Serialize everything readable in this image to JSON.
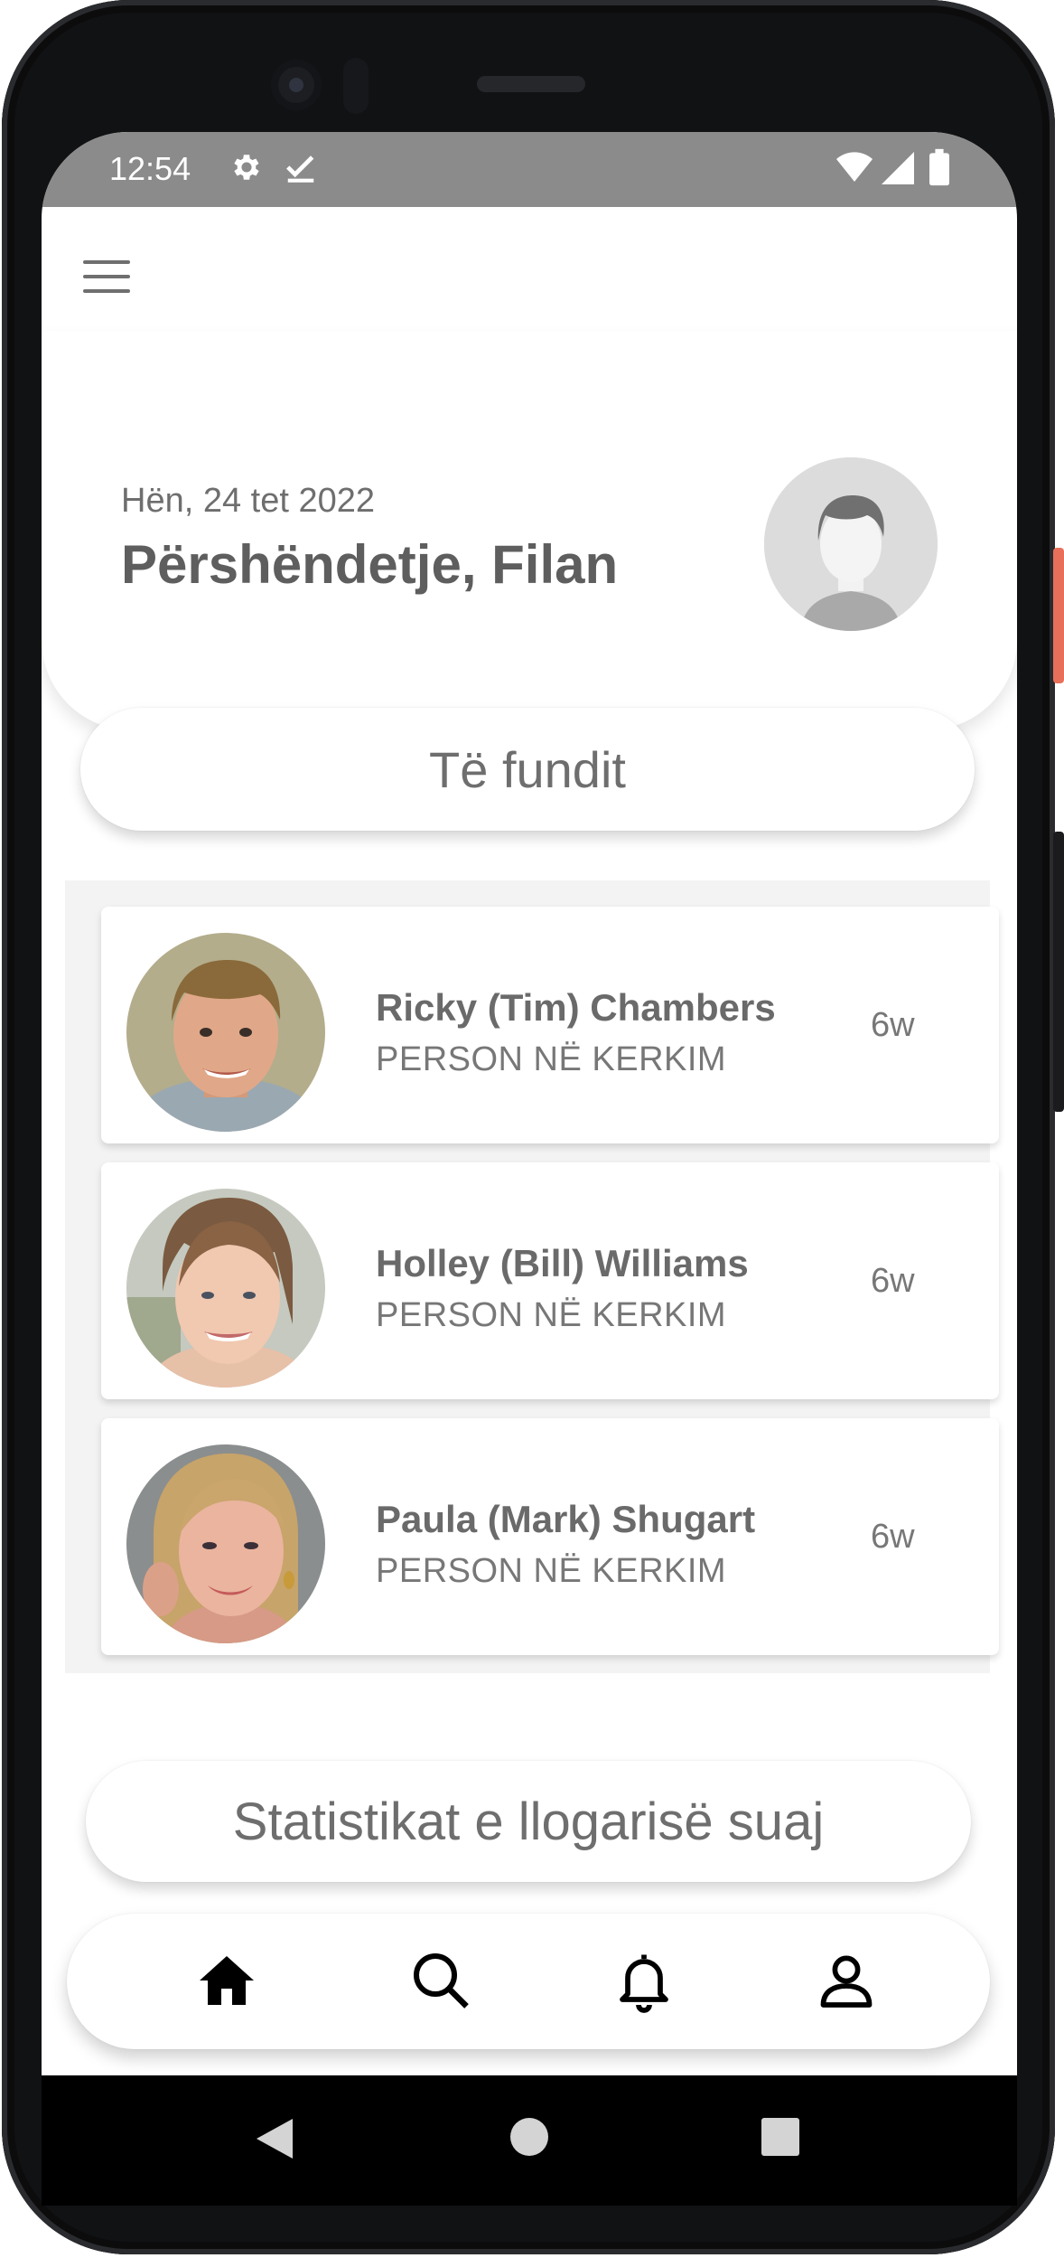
{
  "status_bar": {
    "time": "12:54",
    "left_icons": [
      "settings-gear-icon",
      "download-check-icon"
    ],
    "right_icons": [
      "wifi-icon",
      "cell-signal-icon",
      "battery-icon"
    ]
  },
  "toolbar": {
    "menu_icon": "hamburger-menu-icon"
  },
  "header": {
    "date": "Hën, 24 tet 2022",
    "greeting": "Përshëndetje, Filan",
    "avatar_icon": "default-user-avatar"
  },
  "recent_button": {
    "label": "Të fundit"
  },
  "recent_list": [
    {
      "name": "Ricky (Tim) Chambers",
      "status": "PERSON NË KERKIM",
      "age": "6w"
    },
    {
      "name": "Holley (Bill) Williams",
      "status": "PERSON NË KERKIM",
      "age": "6w"
    },
    {
      "name": "Paula (Mark) Shugart",
      "status": "PERSON NË KERKIM",
      "age": "6w"
    }
  ],
  "stats_button": {
    "label": "Statistikat e llogarisë suaj"
  },
  "bottom_nav": {
    "items": [
      "home-icon",
      "search-icon",
      "bell-icon",
      "profile-icon"
    ],
    "active": "home-icon"
  },
  "system_nav": {
    "items": [
      "back-icon",
      "home-circle-icon",
      "recents-square-icon"
    ]
  },
  "colors": {
    "status_bar": "#8b8b8b",
    "text_primary": "#5e5e5e",
    "panel_bg": "#f3f3f3",
    "accent_side_button": "#e8705a"
  }
}
